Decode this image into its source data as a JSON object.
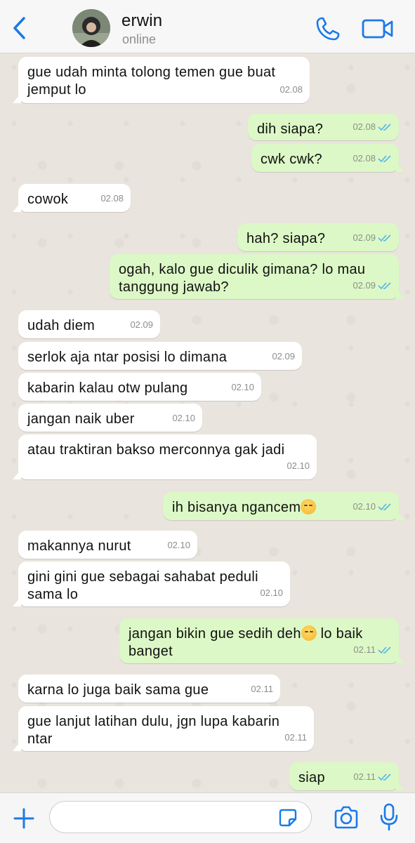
{
  "header": {
    "contact_name": "erwin",
    "status": "online"
  },
  "colors": {
    "accent": "#1a7ae8",
    "incoming_bubble": "#ffffff",
    "outgoing_bubble": "#dcf8c6",
    "read_ticks": "#4fb6ec",
    "chat_background": "#e9e4dd"
  },
  "messages": [
    {
      "dir": "in",
      "lines": [
        "gue udah minta tolong temen gue buat",
        "jemput lo"
      ],
      "time": "02.08"
    },
    {
      "dir": "out",
      "lines": [
        "dih siapa?"
      ],
      "time": "02.08",
      "read": true
    },
    {
      "dir": "out",
      "lines": [
        "cwk cwk?"
      ],
      "time": "02.08",
      "read": true
    },
    {
      "dir": "in",
      "lines": [
        "cowok"
      ],
      "time": "02.08"
    },
    {
      "dir": "out",
      "lines": [
        "hah? siapa?"
      ],
      "time": "02.09",
      "read": true
    },
    {
      "dir": "out",
      "lines": [
        "ogah, kalo gue diculik gimana? lo mau",
        "tanggung jawab?"
      ],
      "time": "02.09",
      "read": true
    },
    {
      "dir": "in",
      "lines": [
        "udah diem"
      ],
      "time": "02.09"
    },
    {
      "dir": "in",
      "lines": [
        "serlok aja ntar posisi lo dimana"
      ],
      "time": "02.09"
    },
    {
      "dir": "in",
      "lines": [
        "kabarin kalau otw pulang"
      ],
      "time": "02.10"
    },
    {
      "dir": "in",
      "lines": [
        "jangan naik uber"
      ],
      "time": "02.10"
    },
    {
      "dir": "in",
      "lines": [
        "atau traktiran bakso merconnya gak jadi"
      ],
      "time": "02.10"
    },
    {
      "dir": "out",
      "lines": [
        "ih bisanya ngancem"
      ],
      "emoji": "grimacing-face-icon",
      "time": "02.10",
      "read": true
    },
    {
      "dir": "in",
      "lines": [
        "makannya nurut"
      ],
      "time": "02.10"
    },
    {
      "dir": "in",
      "lines": [
        "gini gini gue sebagai sahabat peduli",
        "sama lo"
      ],
      "time": "02.10"
    },
    {
      "dir": "out",
      "lines": [
        "jangan bikin gue sedih deh",
        "banget"
      ],
      "emoji": "pensive-face-icon",
      "after_emoji": " lo baik",
      "time": "02.11",
      "read": true
    },
    {
      "dir": "in",
      "lines": [
        "karna lo juga baik sama gue"
      ],
      "time": "02.11"
    },
    {
      "dir": "in",
      "lines": [
        "gue lanjut latihan dulu, jgn lupa kabarin",
        "ntar"
      ],
      "time": "02.11"
    },
    {
      "dir": "out",
      "lines": [
        "siap"
      ],
      "time": "02.11",
      "read": true
    }
  ],
  "input": {
    "value": "",
    "placeholder": ""
  }
}
